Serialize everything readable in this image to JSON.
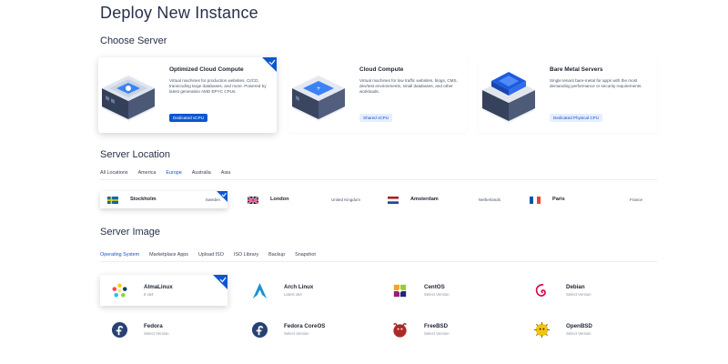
{
  "page": {
    "title": "Deploy New Instance"
  },
  "choose_server": {
    "title": "Choose Server",
    "cards": [
      {
        "title": "Optimized Cloud Compute",
        "description": "Virtual machines for production websites, CI/CD, transcoding large databases, and more. Powered by latest generation AMD EPYC CPUs.",
        "badge": "Dedicated vCPU",
        "selected": true
      },
      {
        "title": "Cloud Compute",
        "description": "Virtual machines for low traffic websites, blogs, CMS, dev/test environments, small databases, and other workloads.",
        "badge": "Shared vCPU",
        "selected": false
      },
      {
        "title": "Bare Metal Servers",
        "description": "Single tenant bare-metal for apps with the most demanding performance or security requirements.",
        "badge": "Dedicated Physical CPU",
        "selected": false
      }
    ]
  },
  "server_location": {
    "title": "Server Location",
    "tabs": [
      "All Locations",
      "America",
      "Europe",
      "Australia",
      "Asia"
    ],
    "active_tab": "Europe",
    "locations": [
      {
        "city": "Stockholm",
        "country": "Sweden",
        "flag": "sweden-flag",
        "selected": true
      },
      {
        "city": "London",
        "country": "United Kingdom",
        "flag": "uk-flag",
        "selected": false
      },
      {
        "city": "Amsterdam",
        "country": "Netherlands",
        "flag": "netherlands-flag",
        "selected": false
      },
      {
        "city": "Paris",
        "country": "France",
        "flag": "france-flag",
        "selected": false
      }
    ]
  },
  "server_image": {
    "title": "Server Image",
    "tabs": [
      "Operating System",
      "Marketplace Apps",
      "Upload ISO",
      "ISO Library",
      "Backup",
      "Snapshot"
    ],
    "active_tab": "Operating System",
    "images": [
      {
        "name": "AlmaLinux",
        "version": "8 x64",
        "icon": "almalinux-icon",
        "selected": true
      },
      {
        "name": "Arch Linux",
        "version": "Latest x64",
        "icon": "archlinux-icon",
        "selected": false
      },
      {
        "name": "CentOS",
        "version": "Select Version",
        "icon": "centos-icon",
        "selected": false
      },
      {
        "name": "Debian",
        "version": "Select Version",
        "icon": "debian-icon",
        "selected": false
      },
      {
        "name": "Fedora",
        "version": "Select Version",
        "icon": "fedora-icon",
        "selected": false
      },
      {
        "name": "Fedora CoreOS",
        "version": "Select Version",
        "icon": "fedora-coreos-icon",
        "selected": false
      },
      {
        "name": "FreeBSD",
        "version": "Select Version",
        "icon": "freebsd-icon",
        "selected": false
      },
      {
        "name": "OpenBSD",
        "version": "Select Version",
        "icon": "openbsd-icon",
        "selected": false
      }
    ]
  },
  "colors": {
    "accent": "#0b57d0",
    "badge_light": "#e6efff",
    "text": "#1c2333"
  }
}
